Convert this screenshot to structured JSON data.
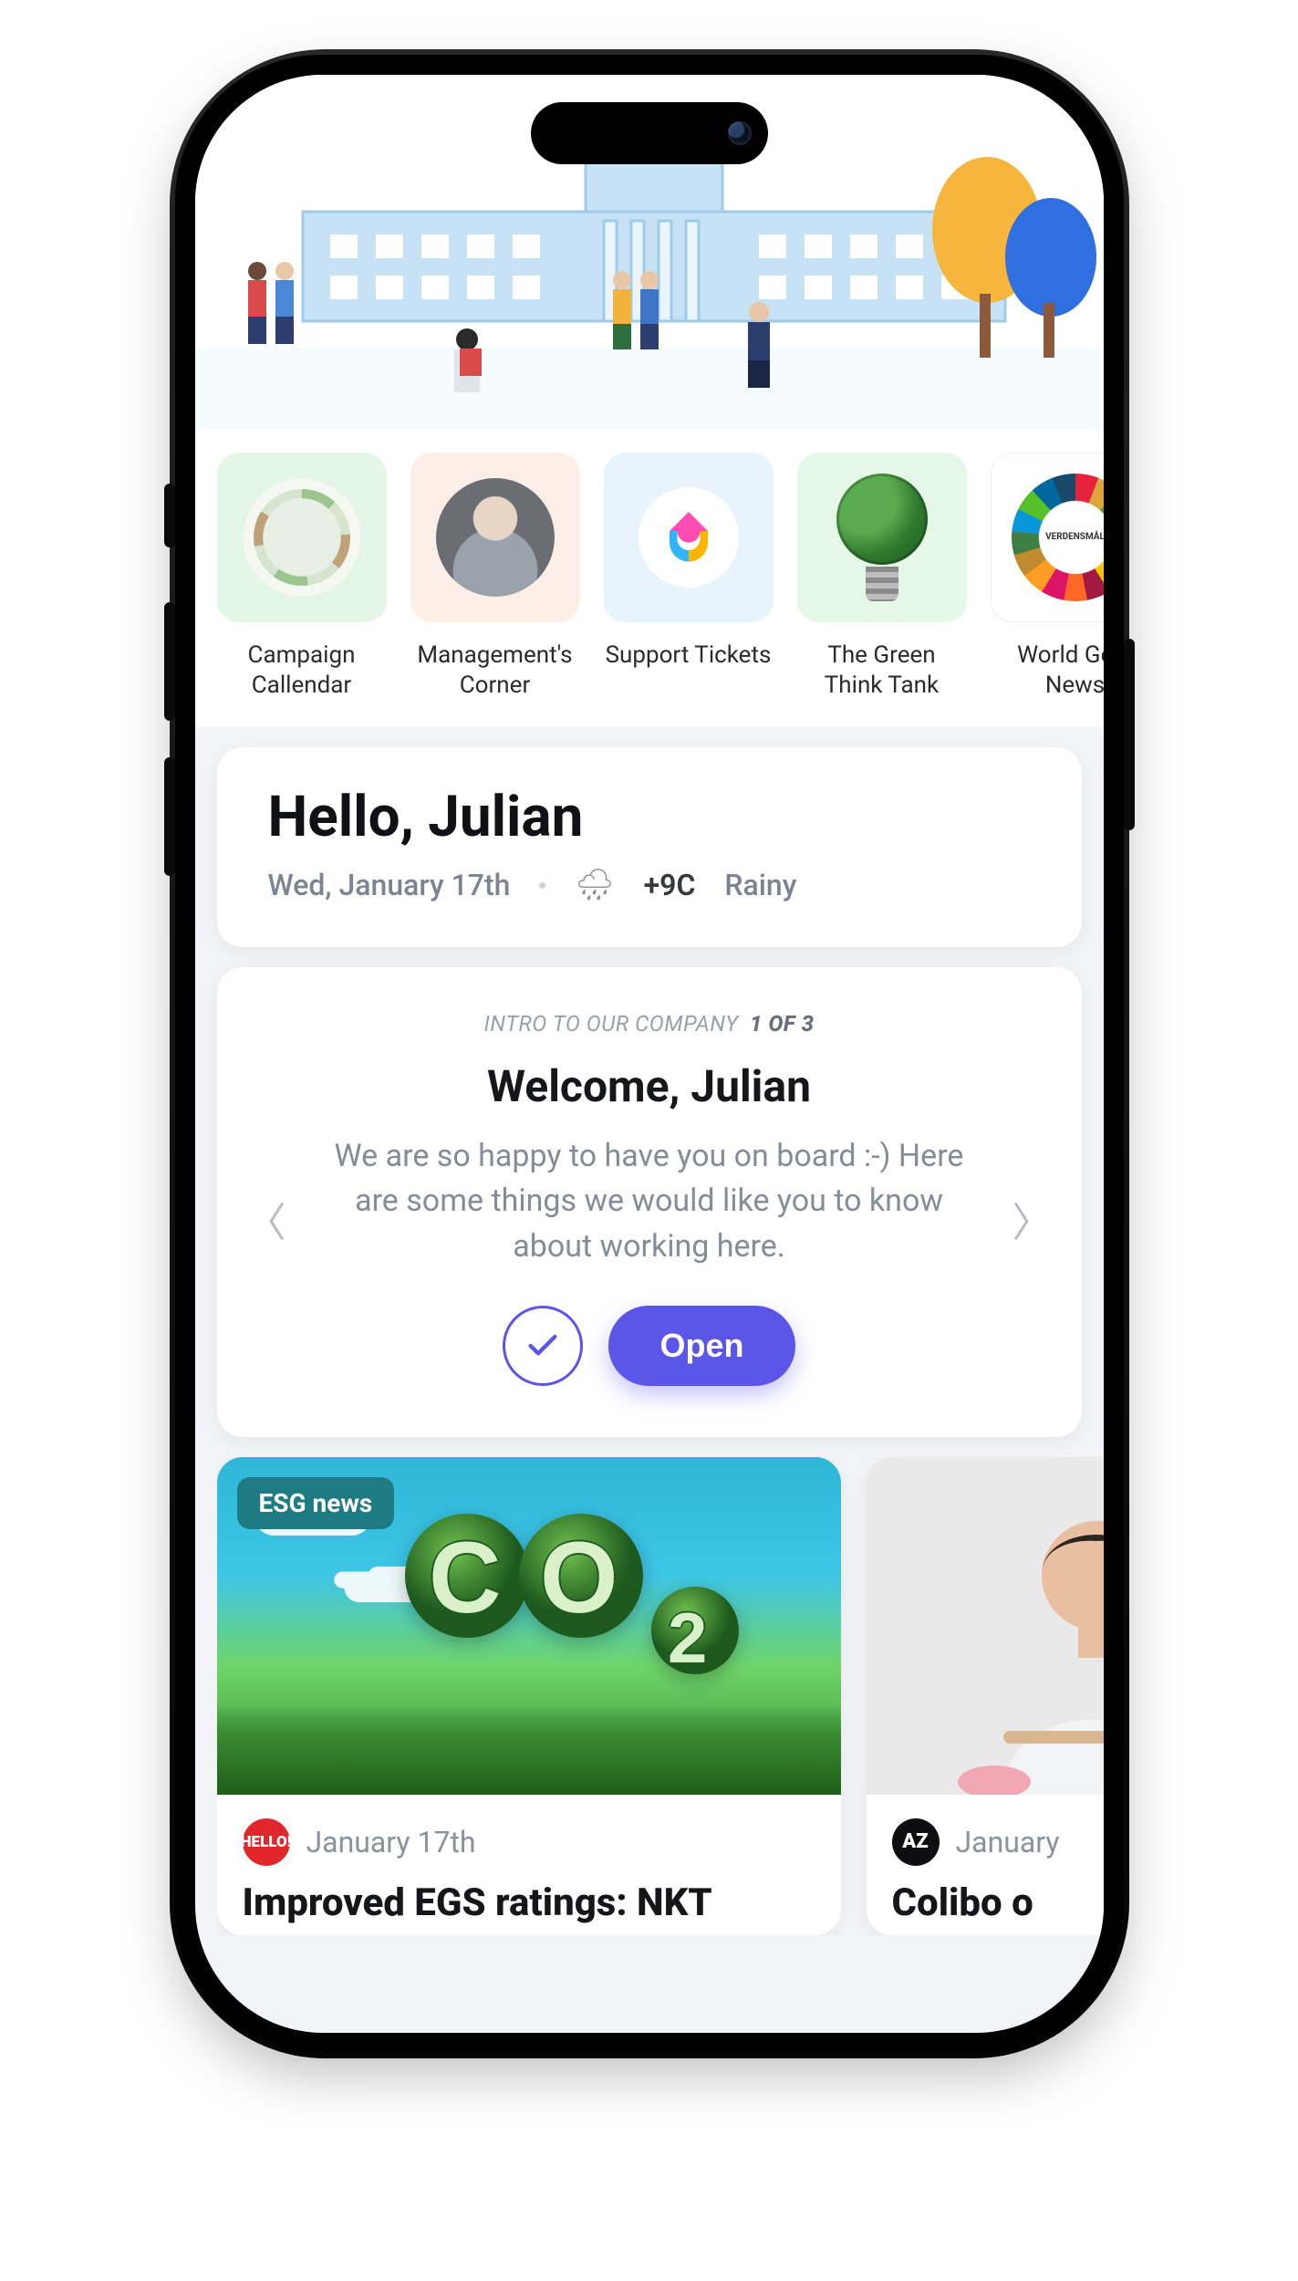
{
  "tiles": [
    {
      "label": "Campaign Callendar"
    },
    {
      "label": "Management's Corner"
    },
    {
      "label": "Support Tickets"
    },
    {
      "label": "The Green Think Tank"
    },
    {
      "label": "World Goal News"
    }
  ],
  "greeting": {
    "title": "Hello, Julian",
    "date": "Wed, January 17th",
    "temp": "+9C",
    "condition": "Rainy"
  },
  "intro": {
    "eyebrow": "INTRO TO OUR COMPANY",
    "counter": "1 OF 3",
    "title": "Welcome, Julian",
    "body": "We are so happy to have you on board :-) Here are some things we would like you to know about working here.",
    "open_label": "Open"
  },
  "news": [
    {
      "tag": "ESG news",
      "badge": "HELLO!",
      "date": "January 17th",
      "headline": "Improved EGS ratings: NKT"
    },
    {
      "badge": "AZ",
      "date": "January",
      "headline": "Colibo o"
    }
  ]
}
